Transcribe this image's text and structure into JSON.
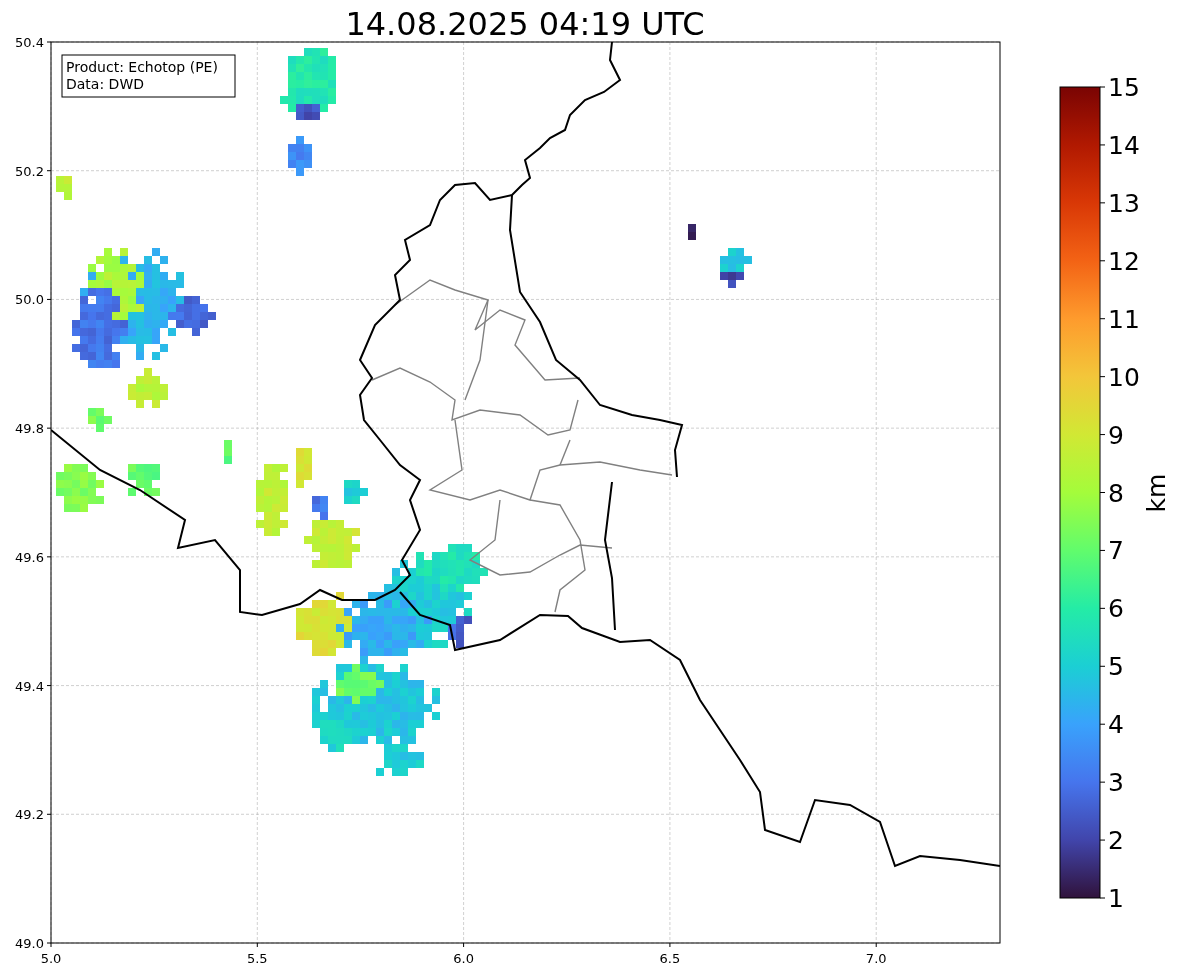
{
  "title": "14.08.2025 04:19 UTC",
  "info_box": {
    "lines": [
      "Product: Echotop (PE)",
      "Data: DWD"
    ]
  },
  "x_axis": {
    "ticks": [
      "5.0",
      "5.5",
      "6.0",
      "6.5",
      "7.0"
    ]
  },
  "y_axis": {
    "ticks": [
      "50.4",
      "50.2",
      "50.0",
      "49.8",
      "49.6",
      "49.4",
      "49.2",
      "49.0"
    ]
  },
  "colorbar": {
    "label": "km",
    "ticks": [
      "15",
      "14",
      "13",
      "12",
      "11",
      "10",
      "9",
      "8",
      "7",
      "6",
      "5",
      "4",
      "3",
      "2",
      "1"
    ]
  }
}
